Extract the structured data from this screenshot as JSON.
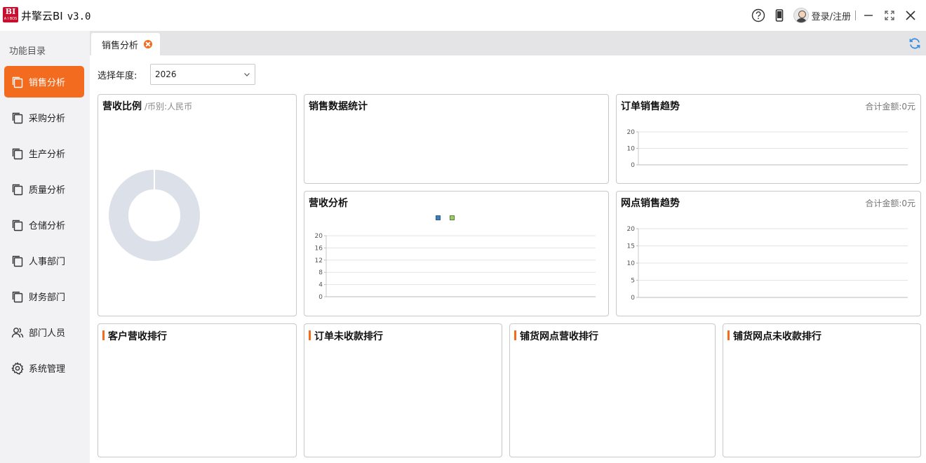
{
  "app": {
    "title": "井擎云BI",
    "version": "v3.0",
    "logo_text": "BI",
    "login_label": "登录/注册"
  },
  "sidebar": {
    "heading": "功能目录",
    "items": [
      {
        "label": "销售分析",
        "icon": "copy-icon",
        "active": true
      },
      {
        "label": "采购分析",
        "icon": "copy-icon"
      },
      {
        "label": "生产分析",
        "icon": "copy-icon"
      },
      {
        "label": "质量分析",
        "icon": "copy-icon"
      },
      {
        "label": "仓储分析",
        "icon": "copy-icon"
      },
      {
        "label": "人事部门",
        "icon": "copy-icon"
      },
      {
        "label": "财务部门",
        "icon": "copy-icon"
      },
      {
        "label": "部门人员",
        "icon": "users-icon"
      },
      {
        "label": "系统管理",
        "icon": "gear-icon"
      }
    ]
  },
  "tabs": [
    {
      "label": "销售分析",
      "closable": true
    }
  ],
  "filter": {
    "label": "选择年度:",
    "year": "2026"
  },
  "panels": {
    "revenue_ratio": {
      "title": "营收比例",
      "subtitle": "/币别:人民币"
    },
    "sales_stats": {
      "title": "销售数据统计"
    },
    "order_trend": {
      "title": "订单销售趋势",
      "total": "合计金额:0元"
    },
    "revenue_analysis": {
      "title": "营收分析"
    },
    "outlet_trend": {
      "title": "网点销售趋势",
      "total": "合计金额:0元"
    },
    "customer_rank": {
      "title": "客户营收排行"
    },
    "order_unpaid_rank": {
      "title": "订单未收款排行"
    },
    "outlet_revenue_rank": {
      "title": "铺货网点营收排行"
    },
    "outlet_unpaid_rank": {
      "title": "铺货网点未收款排行"
    }
  },
  "colors": {
    "accent": "#f26b1f",
    "donut": "#dce0e8",
    "legend1": "#3d7ec0",
    "legend2": "#9ccc65"
  },
  "chart_data": [
    {
      "id": "revenue_ratio",
      "type": "pie",
      "values": [],
      "title": "营收比例"
    },
    {
      "id": "order_trend",
      "type": "line",
      "series": [],
      "yticks": [
        "0",
        "10",
        "20"
      ],
      "ylim": [
        0,
        20
      ],
      "grid": true
    },
    {
      "id": "revenue_analysis",
      "type": "bar",
      "series": [],
      "yticks": [
        "0",
        "4",
        "8",
        "12",
        "16",
        "20"
      ],
      "ylim": [
        0,
        20
      ],
      "grid": true,
      "legend": "top-center"
    },
    {
      "id": "outlet_trend",
      "type": "line",
      "series": [],
      "yticks": [
        "0",
        "5",
        "10",
        "15",
        "20"
      ],
      "ylim": [
        0,
        20
      ],
      "grid": true
    }
  ]
}
